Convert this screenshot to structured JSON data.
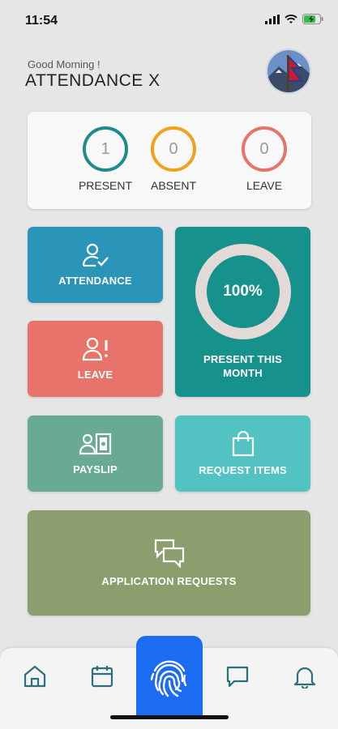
{
  "status_bar": {
    "time": "11:54"
  },
  "header": {
    "greeting": "Good Morning !",
    "title": "ATTENDANCE X"
  },
  "stats": [
    {
      "value": "1",
      "label": "PRESENT",
      "color": "#1f8b8a"
    },
    {
      "value": "0",
      "label": "ABSENT",
      "color": "#f1a11e"
    },
    {
      "value": "0",
      "label": "LEAVE",
      "color": "#e8736a"
    }
  ],
  "tiles": {
    "attendance": {
      "label": "ATTENDANCE",
      "icon": "user-check-icon",
      "color": "#2a95b8"
    },
    "leave": {
      "label": "LEAVE",
      "icon": "user-alert-icon",
      "color": "#e8736a"
    },
    "present_month": {
      "value": "100%",
      "label": "PRESENT THIS MONTH",
      "color": "#16918c"
    },
    "payslip": {
      "label": "PAYSLIP",
      "icon": "payslip-icon",
      "color": "#68ab92"
    },
    "request_items": {
      "label": "REQUEST ITEMS",
      "icon": "shopping-bag-icon",
      "color": "#52c2c2"
    },
    "application_requests": {
      "label": "APPLICATION REQUESTS",
      "icon": "chat-bubbles-icon",
      "color": "#8c9d6e"
    }
  },
  "bottom_nav": {
    "items": [
      "home-icon",
      "calendar-icon",
      "fingerprint-icon",
      "chat-icon",
      "bell-icon"
    ],
    "accent": "#1b6cf0",
    "icon_color": "#2e6f7e"
  }
}
